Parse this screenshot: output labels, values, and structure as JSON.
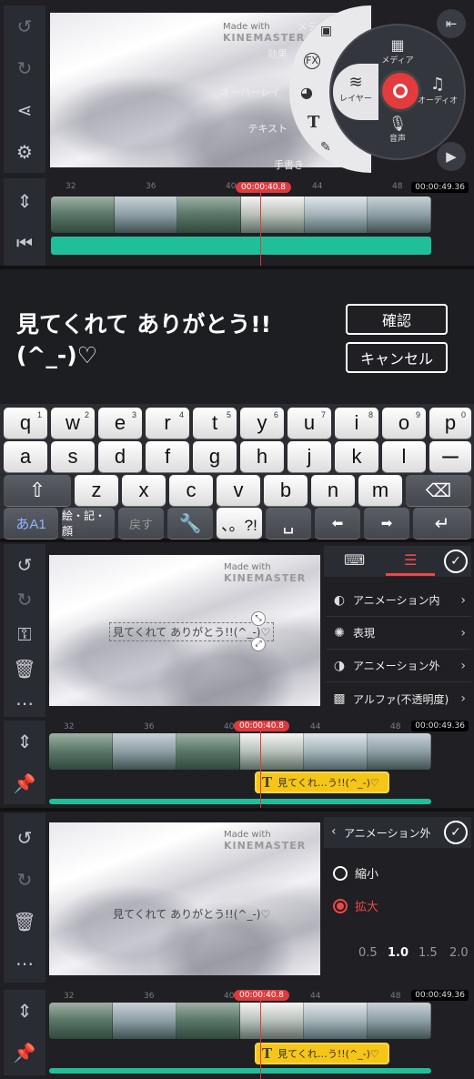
{
  "timeline": {
    "playhead": "00:00:40.8",
    "total": "00:00:49.36",
    "ticks": [
      "32",
      "36",
      "40",
      "44",
      "48"
    ]
  },
  "watermark": {
    "prefix": "Made with",
    "brand": "KINEMASTER"
  },
  "panel1": {
    "side_menu": [
      "メディア",
      "効果",
      "オーバーレイ",
      "テキスト",
      "手書き"
    ],
    "wheel": {
      "media": "メディア",
      "layer": "レイヤー",
      "audio": "オーディオ",
      "voice": "音声"
    }
  },
  "panel2": {
    "text_input": "見てくれて ありがとう!!(^_-)♡",
    "confirm": "確認",
    "cancel": "キャンセル"
  },
  "keyboard": {
    "row1": [
      [
        "q",
        "1"
      ],
      [
        "w",
        "2"
      ],
      [
        "e",
        "3"
      ],
      [
        "r",
        "4"
      ],
      [
        "t",
        "5"
      ],
      [
        "y",
        "6"
      ],
      [
        "u",
        "7"
      ],
      [
        "i",
        "8"
      ],
      [
        "o",
        "9"
      ],
      [
        "p",
        "0"
      ]
    ],
    "row2": [
      "a",
      "s",
      "d",
      "f",
      "g",
      "h",
      "j",
      "k",
      "l",
      "ー"
    ],
    "row3": [
      "z",
      "x",
      "c",
      "v",
      "b",
      "n",
      "m"
    ],
    "mode": "あA1",
    "symbols": "絵・記・顔",
    "undo": "戻す",
    "punct": "、。?!"
  },
  "panel3": {
    "caption": "見てくれて ありがとう!!(^_-)♡",
    "menu": [
      "アニメーション内",
      "表現",
      "アニメーション外",
      "アルファ(不透明度)"
    ],
    "clip_label": "見てくれ…う!!(^_-)♡"
  },
  "panel4": {
    "caption": "見てくれて ありがとう!!(^_-)♡",
    "header": "アニメーション外",
    "options": [
      "縮小",
      "拡大"
    ],
    "selected": "拡大",
    "speeds": [
      "0.5",
      "1.0",
      "1.5",
      "2.0"
    ],
    "selected_speed": "1.0",
    "clip_label": "見てくれ…う!!(^_-)♡"
  }
}
